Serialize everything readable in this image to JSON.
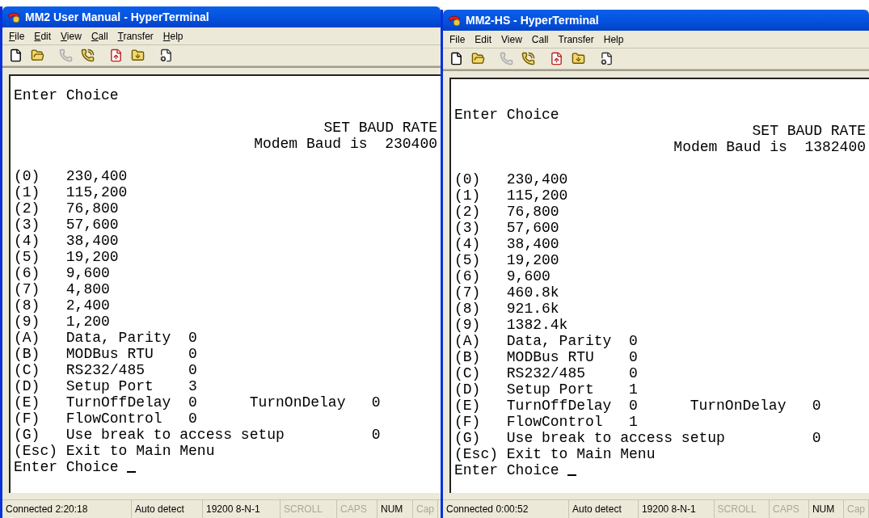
{
  "windows": [
    {
      "title": "MM2 User Manual - HyperTerminal",
      "accelerators_shown": true,
      "menu": [
        "File",
        "Edit",
        "View",
        "Call",
        "Transfer",
        "Help"
      ],
      "terminal": [
        {
          "kind": "text",
          "text": "Enter Choice"
        },
        {
          "kind": "blank"
        },
        {
          "kind": "heading",
          "text": "SET BAUD RATE"
        },
        {
          "kind": "heading",
          "text": "Modem Baud is  230400"
        },
        {
          "kind": "blank"
        },
        {
          "kind": "option",
          "key": "(0)",
          "label": "230,400"
        },
        {
          "kind": "option",
          "key": "(1)",
          "label": "115,200"
        },
        {
          "kind": "option",
          "key": "(2)",
          "label": "76,800"
        },
        {
          "kind": "option",
          "key": "(3)",
          "label": "57,600"
        },
        {
          "kind": "option",
          "key": "(4)",
          "label": "38,400"
        },
        {
          "kind": "option",
          "key": "(5)",
          "label": "19,200"
        },
        {
          "kind": "option",
          "key": "(6)",
          "label": "9,600"
        },
        {
          "kind": "option",
          "key": "(7)",
          "label": "4,800"
        },
        {
          "kind": "option",
          "key": "(8)",
          "label": "2,400"
        },
        {
          "kind": "option",
          "key": "(9)",
          "label": "1,200"
        },
        {
          "kind": "option",
          "key": "(A)",
          "label": "Data, Parity",
          "value": "0"
        },
        {
          "kind": "option",
          "key": "(B)",
          "label": "MODBus RTU",
          "value": "0"
        },
        {
          "kind": "option",
          "key": "(C)",
          "label": "RS232/485",
          "value": "0"
        },
        {
          "kind": "option",
          "key": "(D)",
          "label": "Setup Port",
          "value": "3"
        },
        {
          "kind": "option",
          "key": "(E)",
          "label": "TurnOffDelay",
          "value": "0",
          "extra_label": "TurnOnDelay",
          "extra_value": "0"
        },
        {
          "kind": "option",
          "key": "(F)",
          "label": "FlowControl",
          "value": "0"
        },
        {
          "kind": "option",
          "key": "(G)",
          "label": "Use break to access setup",
          "extra_value": "0"
        },
        {
          "kind": "text",
          "text": "(Esc) Exit to Main Menu"
        },
        {
          "kind": "prompt",
          "text": "Enter Choice"
        }
      ],
      "status": [
        {
          "text": "Connected 2:20:18",
          "disabled": false
        },
        {
          "text": "Auto detect",
          "disabled": false
        },
        {
          "text": "19200 8-N-1",
          "disabled": false
        },
        {
          "text": "SCROLL",
          "disabled": true
        },
        {
          "text": "CAPS",
          "disabled": true
        },
        {
          "text": "NUM",
          "disabled": false
        },
        {
          "text": "Cap",
          "disabled": true
        }
      ]
    },
    {
      "title": "MM2-HS - HyperTerminal",
      "accelerators_shown": false,
      "menu": [
        "File",
        "Edit",
        "View",
        "Call",
        "Transfer",
        "Help"
      ],
      "terminal": [
        {
          "kind": "blank"
        },
        {
          "kind": "text",
          "text": "Enter Choice"
        },
        {
          "kind": "heading",
          "text": "SET BAUD RATE"
        },
        {
          "kind": "heading",
          "text": "Modem Baud is  1382400"
        },
        {
          "kind": "blank"
        },
        {
          "kind": "option",
          "key": "(0)",
          "label": "230,400"
        },
        {
          "kind": "option",
          "key": "(1)",
          "label": "115,200"
        },
        {
          "kind": "option",
          "key": "(2)",
          "label": "76,800"
        },
        {
          "kind": "option",
          "key": "(3)",
          "label": "57,600"
        },
        {
          "kind": "option",
          "key": "(4)",
          "label": "38,400"
        },
        {
          "kind": "option",
          "key": "(5)",
          "label": "19,200"
        },
        {
          "kind": "option",
          "key": "(6)",
          "label": "9,600"
        },
        {
          "kind": "option",
          "key": "(7)",
          "label": "460.8k"
        },
        {
          "kind": "option",
          "key": "(8)",
          "label": "921.6k"
        },
        {
          "kind": "option",
          "key": "(9)",
          "label": "1382.4k"
        },
        {
          "kind": "option",
          "key": "(A)",
          "label": "Data, Parity",
          "value": "0"
        },
        {
          "kind": "option",
          "key": "(B)",
          "label": "MODBus RTU",
          "value": "0"
        },
        {
          "kind": "option",
          "key": "(C)",
          "label": "RS232/485",
          "value": "0"
        },
        {
          "kind": "option",
          "key": "(D)",
          "label": "Setup Port",
          "value": "1"
        },
        {
          "kind": "option",
          "key": "(E)",
          "label": "TurnOffDelay",
          "value": "0",
          "extra_label": "TurnOnDelay",
          "extra_value": "0"
        },
        {
          "kind": "option",
          "key": "(F)",
          "label": "FlowControl",
          "value": "1"
        },
        {
          "kind": "option",
          "key": "(G)",
          "label": "Use break to access setup",
          "extra_value": "0"
        },
        {
          "kind": "text",
          "text": "(Esc) Exit to Main Menu"
        },
        {
          "kind": "prompt",
          "text": "Enter Choice"
        }
      ],
      "status": [
        {
          "text": "Connected 0:00:52",
          "disabled": false
        },
        {
          "text": "Auto detect",
          "disabled": false
        },
        {
          "text": "19200 8-N-1",
          "disabled": false
        },
        {
          "text": "SCROLL",
          "disabled": true
        },
        {
          "text": "CAPS",
          "disabled": true
        },
        {
          "text": "NUM",
          "disabled": false
        },
        {
          "text": "Cap",
          "disabled": true
        }
      ]
    }
  ]
}
